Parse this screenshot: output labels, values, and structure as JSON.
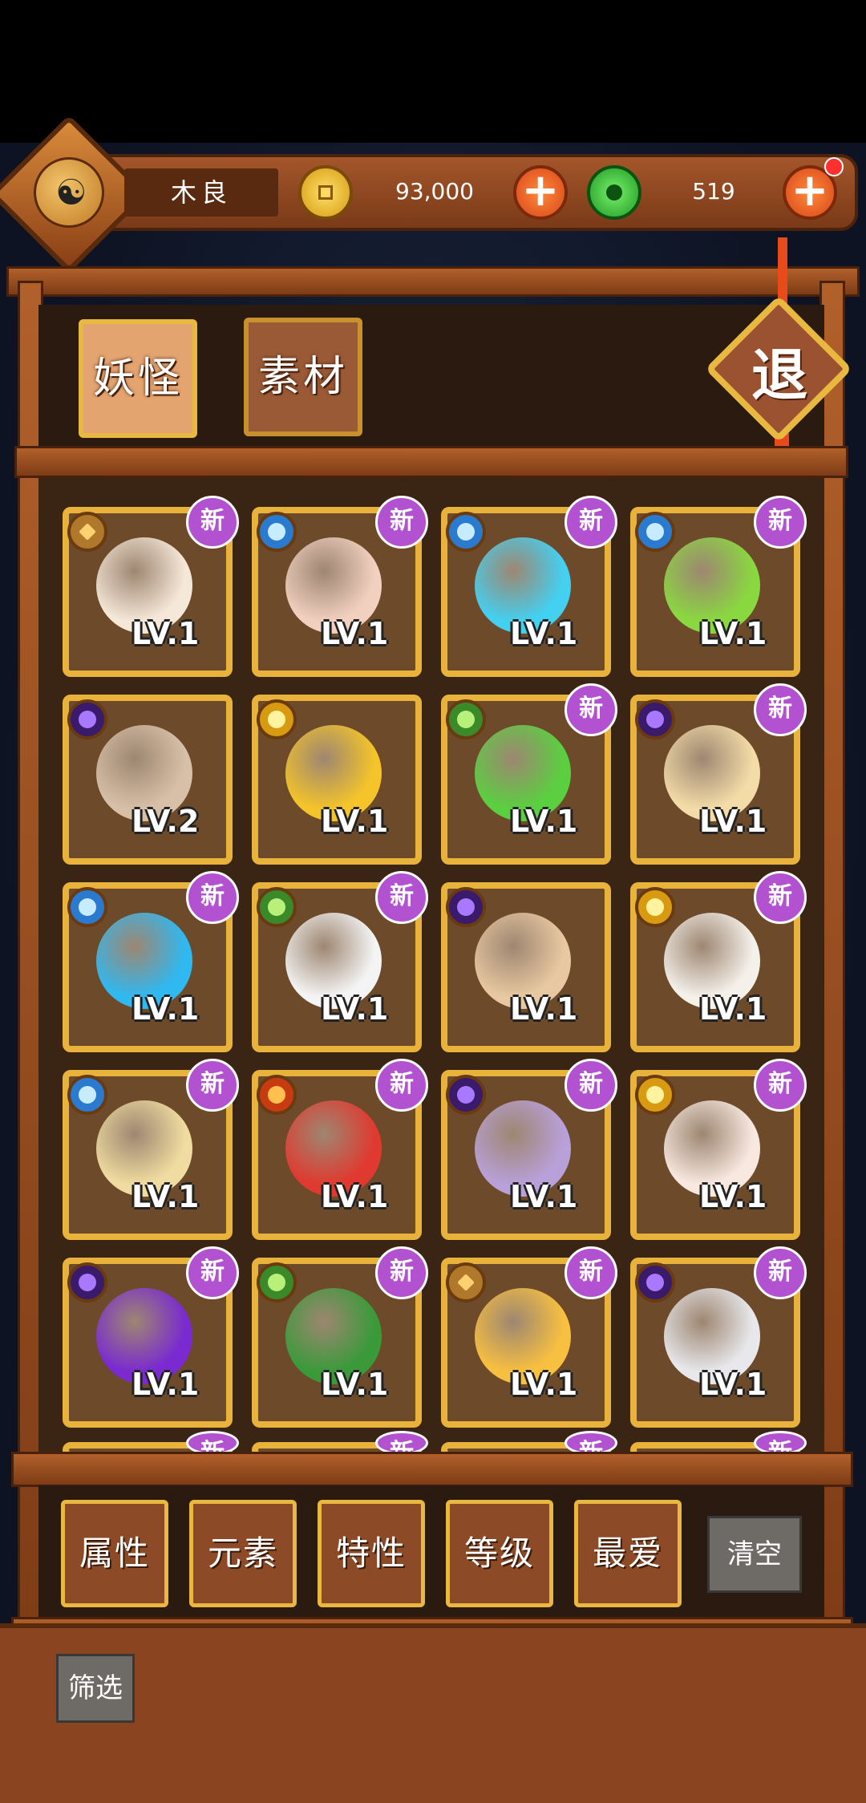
{
  "player": {
    "name": "木良",
    "gold": "93,000",
    "jade": "519"
  },
  "tabs": [
    {
      "label": "妖怪"
    },
    {
      "label": "素材"
    }
  ],
  "quit_label": "退",
  "cards": [
    {
      "monster": "tiger-cat-monster",
      "element": "earth",
      "level": "LV.1",
      "is_new": true,
      "new_label": "新",
      "color": "#f6e8d8"
    },
    {
      "monster": "fan-pig-monster",
      "element": "water",
      "level": "LV.1",
      "is_new": true,
      "new_label": "新",
      "color": "#f2d0c0"
    },
    {
      "monster": "libra-star-monster",
      "element": "water",
      "level": "LV.1",
      "is_new": true,
      "new_label": "新",
      "color": "#44d0f0"
    },
    {
      "monster": "ring-ghost-monster",
      "element": "water",
      "level": "LV.1",
      "is_new": true,
      "new_label": "新",
      "color": "#8ad840"
    },
    {
      "monster": "hat-boy-monster",
      "element": "dark",
      "level": "LV.2",
      "is_new": false,
      "new_label": "",
      "color": "#d8c0a8"
    },
    {
      "monster": "gold-ingot-monster",
      "element": "light",
      "level": "LV.1",
      "is_new": false,
      "new_label": "",
      "color": "#f4c42a"
    },
    {
      "monster": "aries-star-monster",
      "element": "wood",
      "level": "LV.1",
      "is_new": true,
      "new_label": "新",
      "color": "#5ad040"
    },
    {
      "monster": "tofu-monster",
      "element": "dark",
      "level": "LV.1",
      "is_new": true,
      "new_label": "新",
      "color": "#f4dca8"
    },
    {
      "monster": "aquarius-star-monster",
      "element": "water",
      "level": "LV.1",
      "is_new": true,
      "new_label": "新",
      "color": "#30b8f0"
    },
    {
      "monster": "leaf-cat-monster",
      "element": "wood",
      "level": "LV.1",
      "is_new": true,
      "new_label": "新",
      "color": "#f4f4f4"
    },
    {
      "monster": "sword-monk-monster",
      "element": "dark",
      "level": "LV.1",
      "is_new": false,
      "new_label": "",
      "color": "#e8c8a0"
    },
    {
      "monster": "box-mouse-monster",
      "element": "light",
      "level": "LV.1",
      "is_new": true,
      "new_label": "新",
      "color": "#f4f0ea"
    },
    {
      "monster": "sprout-monster",
      "element": "water",
      "level": "LV.1",
      "is_new": true,
      "new_label": "新",
      "color": "#f0dca0"
    },
    {
      "monster": "yarn-ball-monster",
      "element": "fire",
      "level": "LV.1",
      "is_new": true,
      "new_label": "新",
      "color": "#e03a30"
    },
    {
      "monster": "cabbage-monster",
      "element": "dark",
      "level": "LV.1",
      "is_new": true,
      "new_label": "新",
      "color": "#b8a0d8"
    },
    {
      "monster": "cow-monster",
      "element": "light",
      "level": "LV.1",
      "is_new": true,
      "new_label": "新",
      "color": "#f8e8e0"
    },
    {
      "monster": "purple-orb-monster",
      "element": "dark",
      "level": "LV.1",
      "is_new": true,
      "new_label": "新",
      "color": "#7a2ad0"
    },
    {
      "monster": "green-frog-monster",
      "element": "wood",
      "level": "LV.1",
      "is_new": true,
      "new_label": "新",
      "color": "#3a9a3a"
    },
    {
      "monster": "sun-moon-monster",
      "element": "earth",
      "level": "LV.1",
      "is_new": true,
      "new_label": "新",
      "color": "#f8c040"
    },
    {
      "monster": "horned-mummy-monster",
      "element": "dark",
      "level": "LV.1",
      "is_new": true,
      "new_label": "新",
      "color": "#e8e8ec"
    }
  ],
  "partial_row": [
    {
      "is_new": true,
      "new_label": "新"
    },
    {
      "is_new": true,
      "new_label": "新"
    },
    {
      "is_new": true,
      "new_label": "新"
    },
    {
      "is_new": true,
      "new_label": "新"
    }
  ],
  "filters": [
    {
      "label": "属性"
    },
    {
      "label": "元素"
    },
    {
      "label": "特性"
    },
    {
      "label": "等级"
    },
    {
      "label": "最爱"
    }
  ],
  "clear_label": "清空",
  "screen_label": "筛选"
}
